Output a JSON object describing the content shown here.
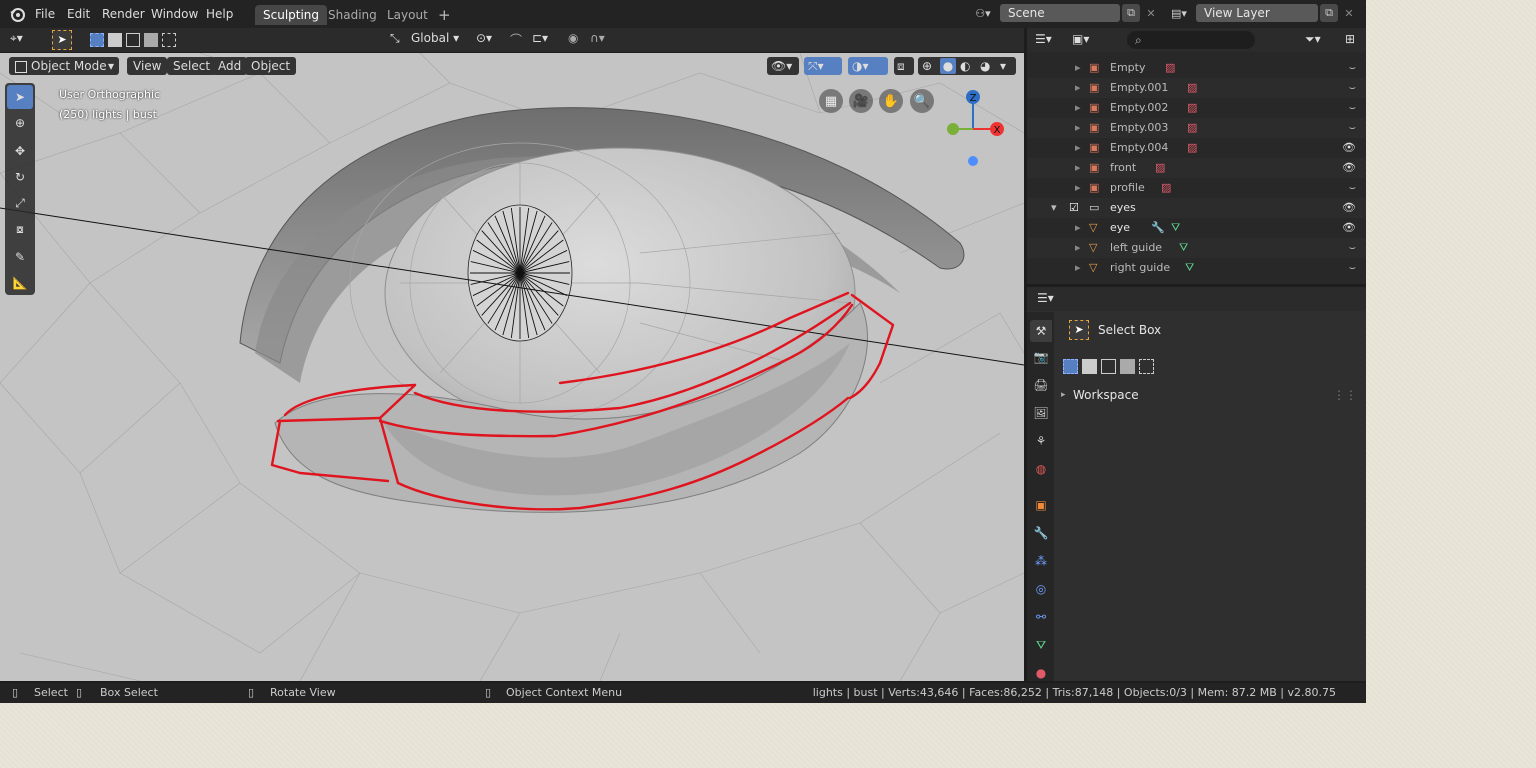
{
  "menus": [
    "File",
    "Edit",
    "Render",
    "Window",
    "Help"
  ],
  "workspaces": [
    "Sculpting",
    "Shading",
    "Layout"
  ],
  "add_workspace": "+",
  "scene": "Scene",
  "view_layer": "View Layer",
  "viewport": {
    "transform_orientation": "Global",
    "mode": "Object Mode",
    "header_menus": [
      "View",
      "Select",
      "Add",
      "Object"
    ],
    "info_line1": "User Orthographic",
    "info_line2": "(250) lights | bust",
    "gizmo": {
      "z": "Z",
      "x": "X",
      "y": "Y"
    }
  },
  "outliner": {
    "rows": [
      {
        "label": "Empty",
        "type": "empty",
        "visible": false
      },
      {
        "label": "Empty.001",
        "type": "empty",
        "visible": false
      },
      {
        "label": "Empty.002",
        "type": "empty",
        "visible": false
      },
      {
        "label": "Empty.003",
        "type": "empty",
        "visible": false
      },
      {
        "label": "Empty.004",
        "type": "empty",
        "visible": true
      },
      {
        "label": "front",
        "type": "empty",
        "visible": true
      },
      {
        "label": "profile",
        "type": "empty",
        "visible": false
      },
      {
        "label": "eyes",
        "type": "collection",
        "visible": true
      },
      {
        "label": "eye",
        "type": "mesh",
        "visible": true
      },
      {
        "label": "left guide",
        "type": "mesh",
        "visible": false
      },
      {
        "label": "right guide",
        "type": "mesh",
        "visible": false
      }
    ]
  },
  "properties": {
    "tool_name": "Select Box",
    "panel": "Workspace"
  },
  "status": {
    "select": "Select",
    "box_select": "Box Select",
    "rotate_view": "Rotate View",
    "context_menu": "Object Context Menu",
    "stats": "lights | bust | Verts:43,646 | Faces:86,252 | Tris:87,148 | Objects:0/3 | Mem: 87.2 MB | v2.80.75"
  },
  "colors": {
    "accent": "#5680c2",
    "stroke_red": "#e0141e",
    "empty_icon": "#d9775e",
    "mesh_icon": "#e89e4a",
    "green_icon": "#5bd68b"
  }
}
